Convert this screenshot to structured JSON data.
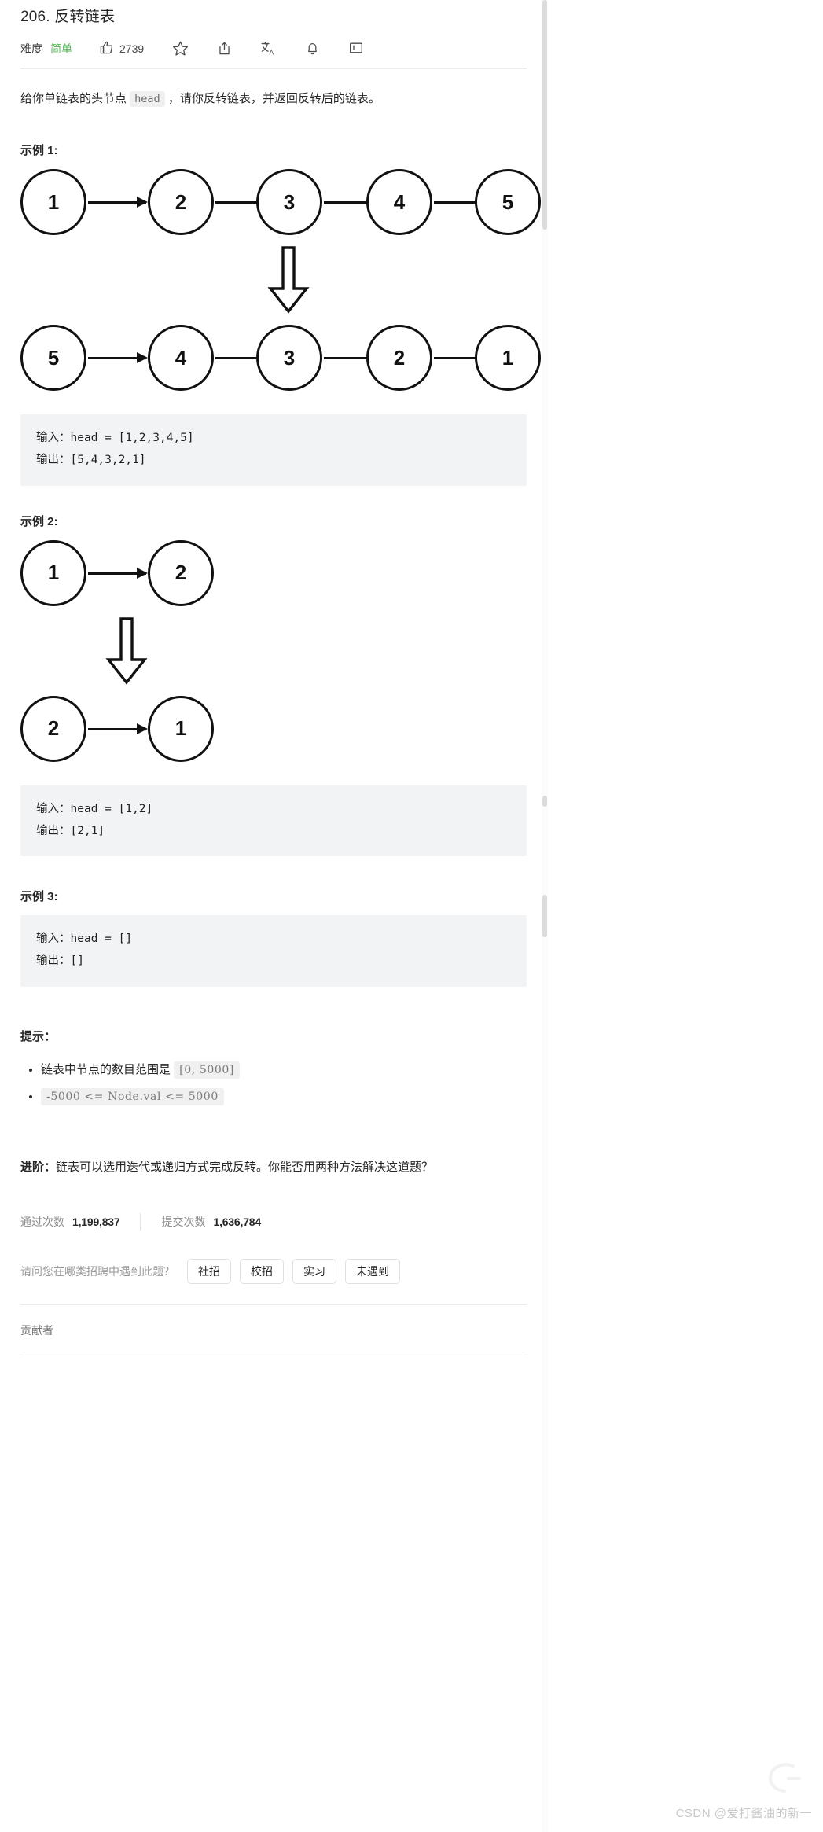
{
  "header": {
    "title": "206. 反转链表",
    "difficulty_label": "难度",
    "difficulty_value": "简单",
    "difficulty_color": "#5cb85c",
    "like_count": "2739",
    "icons": {
      "thumbs_up": "thumbs-up-icon",
      "star": "star-icon",
      "share": "share-icon",
      "translate": "translate-icon",
      "bell": "bell-icon",
      "feedback": "feedback-icon"
    }
  },
  "description": {
    "before_code": "给你单链表的头节点 ",
    "code": "head",
    "after_code": " ，请你反转链表，并返回反转后的链表。"
  },
  "examples": [
    {
      "heading": "示例 1:",
      "diagram": {
        "input_nodes": [
          "1",
          "2",
          "3",
          "4",
          "5"
        ],
        "output_nodes": [
          "5",
          "4",
          "3",
          "2",
          "1"
        ],
        "arrow": "down-block-arrow"
      },
      "code_lines": [
        "输入：head = [1,2,3,4,5]",
        "输出：[5,4,3,2,1]"
      ]
    },
    {
      "heading": "示例 2:",
      "diagram": {
        "input_nodes": [
          "1",
          "2"
        ],
        "output_nodes": [
          "2",
          "1"
        ],
        "arrow": "down-block-arrow"
      },
      "code_lines": [
        "输入：head = [1,2]",
        "输出：[2,1]"
      ]
    },
    {
      "heading": "示例 3:",
      "diagram": null,
      "code_lines": [
        "输入：head = []",
        "输出：[]"
      ]
    }
  ],
  "hints": {
    "title": "提示：",
    "items": [
      {
        "text": "链表中节点的数目范围是 ",
        "code": "[0, 5000]"
      },
      {
        "text": "",
        "code": "-5000 <= Node.val <= 5000"
      }
    ]
  },
  "advanced": {
    "label": "进阶：",
    "text": "链表可以选用迭代或递归方式完成反转。你能否用两种方法解决这道题？"
  },
  "stats": {
    "accepted_label": "通过次数",
    "accepted_value": "1,199,837",
    "submissions_label": "提交次数",
    "submissions_value": "1,636,784"
  },
  "tags": {
    "question": "请问您在哪类招聘中遇到此题？",
    "options": [
      "社招",
      "校招",
      "实习",
      "未遇到"
    ]
  },
  "footer": {
    "contributor_label": "贡献者"
  },
  "watermark": {
    "text": "CSDN @爱打酱油的新一"
  }
}
